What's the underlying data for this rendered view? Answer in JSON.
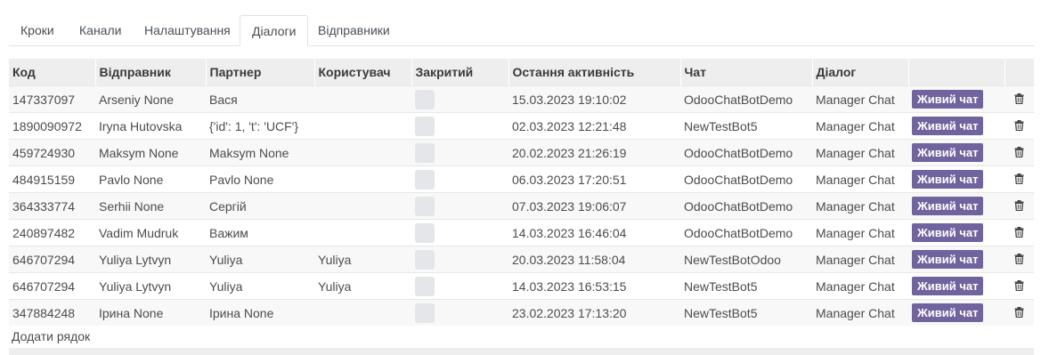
{
  "tabs": [
    {
      "label": "Кроки",
      "active": false
    },
    {
      "label": "Канали",
      "active": false
    },
    {
      "label": "Налаштування",
      "active": false
    },
    {
      "label": "Діалоги",
      "active": true
    },
    {
      "label": "Відправники",
      "active": false
    }
  ],
  "table": {
    "headers": {
      "code": "Код",
      "sender": "Відправник",
      "partner": "Партнер",
      "user": "Користувач",
      "closed": "Закритий",
      "last_activity": "Остання активність",
      "chat": "Чат",
      "dialog": "Діалог"
    },
    "rows": [
      {
        "code": "147337097",
        "sender": "Arseniy None",
        "partner": "Вася",
        "user": "",
        "closed": false,
        "last_activity": "15.03.2023 19:10:02",
        "chat": "OdooChatBotDemo",
        "dialog": "Manager Chat",
        "action": "Живий чат"
      },
      {
        "code": "1890090972",
        "sender": "Iryna Hutovska",
        "partner": "{'id': 1, 't': 'UCF'}",
        "user": "",
        "closed": false,
        "last_activity": "02.03.2023 12:21:48",
        "chat": "NewTestBot5",
        "dialog": "Manager Chat",
        "action": "Живий чат"
      },
      {
        "code": "459724930",
        "sender": "Maksym None",
        "partner": "Maksym None",
        "user": "",
        "closed": false,
        "last_activity": "20.02.2023 21:26:19",
        "chat": "OdooChatBotDemo",
        "dialog": "Manager Chat",
        "action": "Живий чат"
      },
      {
        "code": "484915159",
        "sender": "Pavlo None",
        "partner": "Pavlo None",
        "user": "",
        "closed": false,
        "last_activity": "06.03.2023 17:20:51",
        "chat": "OdooChatBotDemo",
        "dialog": "Manager Chat",
        "action": "Живий чат"
      },
      {
        "code": "364333774",
        "sender": "Serhii None",
        "partner": "Сергій",
        "user": "",
        "closed": false,
        "last_activity": "07.03.2023 19:06:07",
        "chat": "OdooChatBotDemo",
        "dialog": "Manager Chat",
        "action": "Живий чат"
      },
      {
        "code": "240897482",
        "sender": "Vadim Mudruk",
        "partner": "Важим",
        "user": "",
        "closed": false,
        "last_activity": "14.03.2023 16:46:04",
        "chat": "OdooChatBotDemo",
        "dialog": "Manager Chat",
        "action": "Живий чат"
      },
      {
        "code": "646707294",
        "sender": "Yuliya Lytvyn",
        "partner": "Yuliya",
        "user": "Yuliya",
        "closed": false,
        "last_activity": "20.03.2023 11:58:04",
        "chat": "NewTestBotOdoo",
        "dialog": "Manager Chat",
        "action": "Живий чат"
      },
      {
        "code": "646707294",
        "sender": "Yuliya Lytvyn",
        "partner": "Yuliya",
        "user": "Yuliya",
        "closed": false,
        "last_activity": "14.03.2023 16:53:15",
        "chat": "NewTestBot5",
        "dialog": "Manager Chat",
        "action": "Живий чат"
      },
      {
        "code": "347884248",
        "sender": "Ірина None",
        "partner": "Ірина None",
        "user": "",
        "closed": false,
        "last_activity": "23.02.2023 17:13:20",
        "chat": "NewTestBot5",
        "dialog": "Manager Chat",
        "action": "Живий чат"
      }
    ]
  },
  "add_row_label": "Додати рядок",
  "colors": {
    "accent": "#71639e",
    "header_bg": "#eeeeee"
  },
  "icons": {
    "row_delete": "trash-icon"
  }
}
